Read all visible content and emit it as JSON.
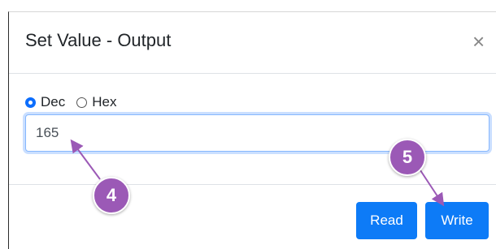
{
  "dialog": {
    "title": "Set Value - Output",
    "close_label": "×"
  },
  "format": {
    "options": [
      {
        "label": "Dec",
        "selected": true
      },
      {
        "label": "Hex",
        "selected": false
      }
    ]
  },
  "value_input": {
    "value": "165"
  },
  "footer": {
    "read_label": "Read",
    "write_label": "Write"
  },
  "annotations": {
    "step_4": "4",
    "step_5": "5",
    "color": "#9b59b6"
  },
  "colors": {
    "button_primary": "#0d7bf7",
    "focus_border": "#86b7fe"
  }
}
